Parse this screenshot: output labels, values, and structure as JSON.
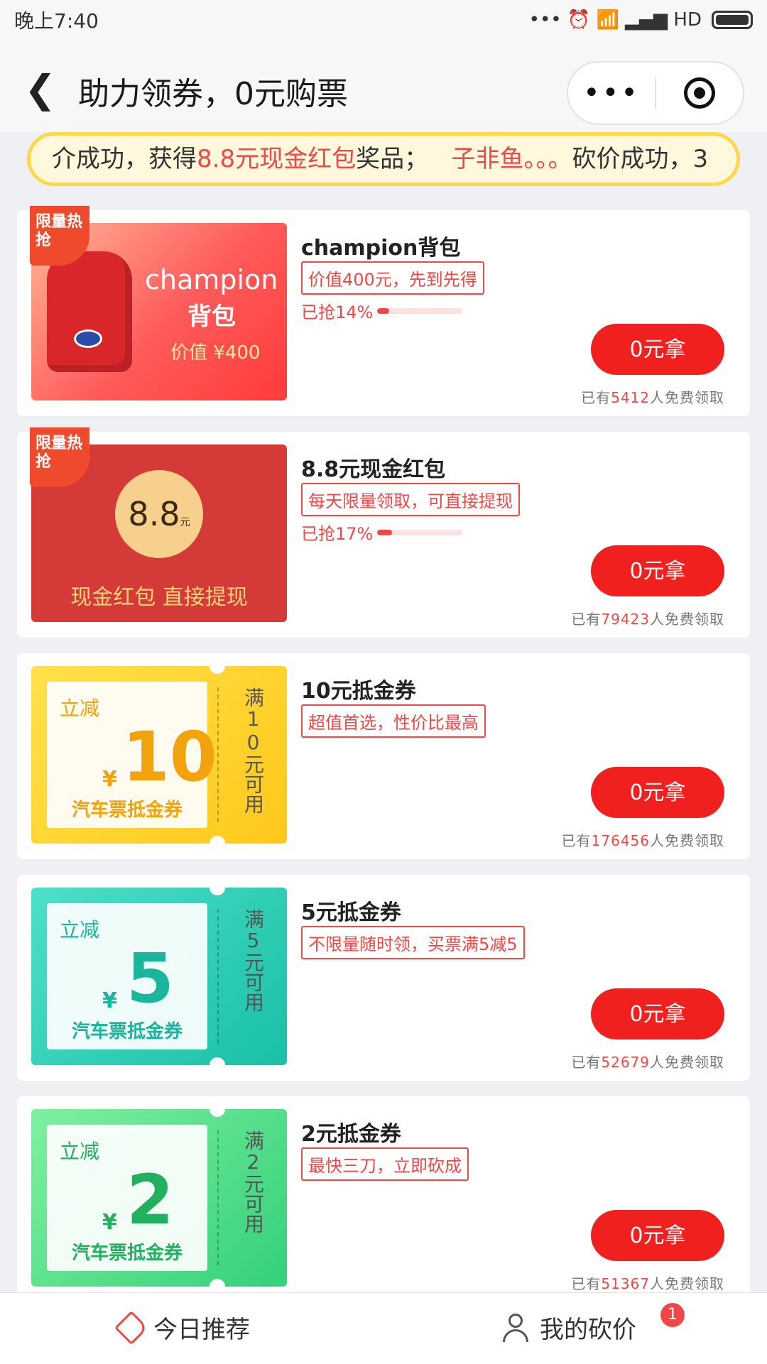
{
  "status_bar": {
    "time": "晚上7:40",
    "indicators": "••• ⏰ 📶 ▂▄▆ HD"
  },
  "nav": {
    "back_icon": "chevron-left-icon",
    "title": "助力领券，0元购票",
    "more_label": "•••",
    "target_icon": "target-icon"
  },
  "marquee": {
    "part1": "介成功，获得",
    "highlight1": "8.8元现金红包",
    "part2": "奖品；",
    "highlight2": "子非鱼。。。",
    "part3": "砍价成功，3"
  },
  "colors": {
    "accent": "#f0201e",
    "brand_red": "#f04848",
    "marquee_border": "#ffd84a"
  },
  "items": [
    {
      "badge": "限量热抢",
      "thumb": {
        "brand": "champion",
        "sub": "背包",
        "price": "价值 ¥400"
      },
      "name": "champion背包",
      "tag": "价值400元，先到先得",
      "grabbed": "已抢14%",
      "progress": 14,
      "button": "0元拿",
      "claimed_prefix": "已有",
      "claimed_count": "5412",
      "claimed_suffix": "人免费领取"
    },
    {
      "badge": "限量热抢",
      "thumb": {
        "amount": "8.8",
        "unit": "元",
        "sub": "现金红包 直接提现"
      },
      "name": "8.8元现金红包",
      "tag": "每天限量领取，可直接提现",
      "grabbed": "已抢17%",
      "progress": 17,
      "button": "0元拿",
      "claimed_prefix": "已有",
      "claimed_count": "79423",
      "claimed_suffix": "人免费领取"
    },
    {
      "thumb": {
        "lijian": "立减",
        "yen": "¥",
        "amount": "10",
        "label": "汽车票抵金券",
        "side": "满10元可用"
      },
      "name": "10元抵金券",
      "tag": "超值首选，性价比最高",
      "button": "0元拿",
      "claimed_prefix": "已有",
      "claimed_count": "176456",
      "claimed_suffix": "人免费领取"
    },
    {
      "thumb": {
        "lijian": "立减",
        "yen": "¥",
        "amount": "5",
        "label": "汽车票抵金券",
        "side": "满5元可用"
      },
      "name": "5元抵金券",
      "tag": "不限量随时领，买票满5减5",
      "button": "0元拿",
      "claimed_prefix": "已有",
      "claimed_count": "52679",
      "claimed_suffix": "人免费领取"
    },
    {
      "thumb": {
        "lijian": "立减",
        "yen": "¥",
        "amount": "2",
        "label": "汽车票抵金券",
        "side": "满2元可用"
      },
      "name": "2元抵金券",
      "tag": "最快三刀，立即砍成",
      "button": "0元拿",
      "claimed_prefix": "已有",
      "claimed_count": "51367",
      "claimed_suffix": "人免费领取"
    }
  ],
  "bottom_nav": {
    "left": {
      "icon": "tag-icon",
      "label": "今日推荐"
    },
    "right": {
      "icon": "user-icon",
      "label": "我的砍价",
      "badge": "1"
    }
  }
}
